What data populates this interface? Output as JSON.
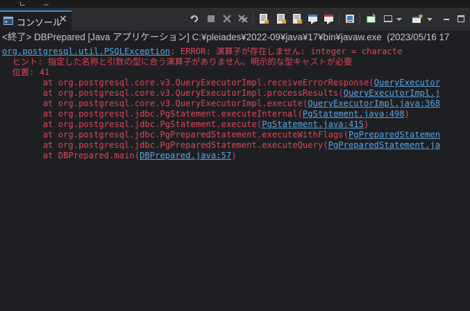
{
  "tab": {
    "label": "コンソール",
    "close": "✕"
  },
  "toolbar": {
    "icons": [
      "rerun-icon",
      "stop-icon",
      "terminate-icon",
      "remove-launches-icon",
      "clear-console-icon",
      "scroll-lock-icon",
      "word-wrap-icon",
      "show-on-stdout-icon",
      "show-on-stderr-icon",
      "pin-console-icon",
      "display-selected-console-icon",
      "open-console-icon",
      "minimize-icon",
      "maximize-icon"
    ]
  },
  "console": {
    "terminated": "<終了> DBPrepared [Java アプリケーション] C:¥pleiades¥2022-09¥java¥17¥bin¥javaw.exe  (2023/05/16 17",
    "lines": [
      {
        "link": "org.postgresql.util.PSQLException",
        "text": ": ERROR: 演算子が存在しません: integer = characte"
      },
      {
        "text": "  ヒント: 指定した名称と引数の型に合う演算子がありません。明示的な型キャストが必要"
      },
      {
        "text": "  位置: 41"
      },
      {
        "text": "\tat org.postgresql.core.v3.QueryExecutorImpl.receiveErrorResponse(",
        "link": "QueryExecutor"
      },
      {
        "text": "\tat org.postgresql.core.v3.QueryExecutorImpl.processResults(",
        "link": "QueryExecutorImpl.j"
      },
      {
        "text": "\tat org.postgresql.core.v3.QueryExecutorImpl.execute(",
        "link": "QueryExecutorImpl.java:368"
      },
      {
        "text": "\tat org.postgresql.jdbc.PgStatement.executeInternal(",
        "link": "PgStatement.java:498",
        "tail": ")"
      },
      {
        "text": "\tat org.postgresql.jdbc.PgStatement.execute(",
        "link": "PgStatement.java:415",
        "tail": ")"
      },
      {
        "text": "\tat org.postgresql.jdbc.PgPreparedStatement.executeWithFlags(",
        "link": "PgPreparedStatemen"
      },
      {
        "text": "\tat org.postgresql.jdbc.PgPreparedStatement.executeQuery(",
        "link": "PgPreparedStatement.ja"
      },
      {
        "text": "\tat DBPrepared.main(",
        "link": "DBPrepared.java:57",
        "tail": ")"
      }
    ]
  }
}
